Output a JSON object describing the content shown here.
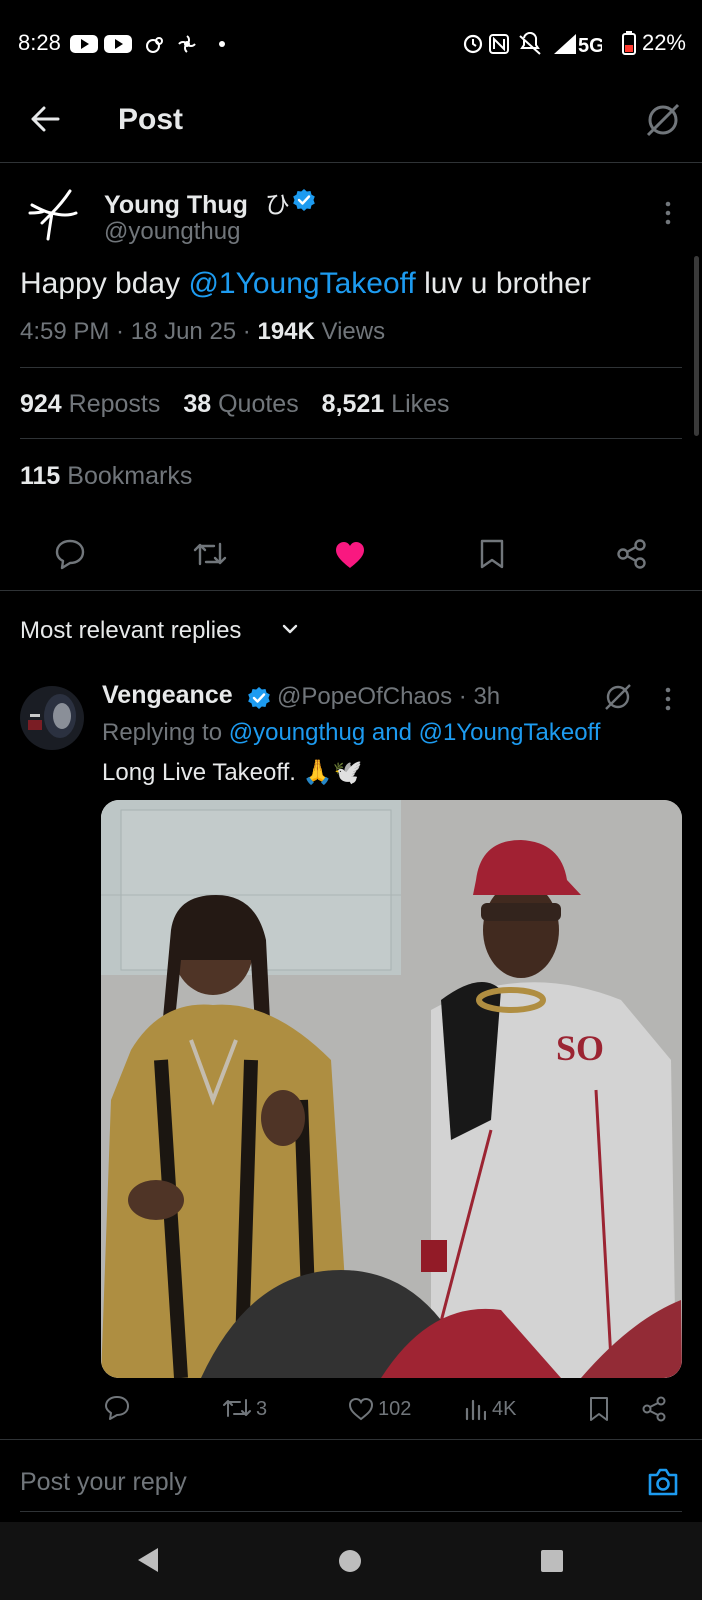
{
  "status_bar": {
    "time": "8:28",
    "network": "5G",
    "battery": "22%"
  },
  "header": {
    "title": "Post"
  },
  "tweet": {
    "author_name": "Young Thug",
    "author_badge_glyph": "ひ",
    "author_handle": "@youngthug",
    "text_prefix": "Happy bday ",
    "text_mention": "@1YoungTakeoff",
    "text_suffix": " luv u brother",
    "time": "4:59 PM",
    "date": "18 Jun 25",
    "views_count": "194K",
    "views_label": " Views",
    "reposts_count": "924",
    "reposts_label": " Reposts",
    "quotes_count": "38",
    "quotes_label": " Quotes",
    "likes_count": "8,521",
    "likes_label": " Likes",
    "bookmarks_count": "115",
    "bookmarks_label": " Bookmarks",
    "liked": true
  },
  "replies_sort": {
    "label": "Most relevant replies"
  },
  "reply": {
    "author_name": "Vengeance",
    "author_handle": "@PopeOfChaos",
    "time_ago": "3h",
    "replying_to_label": "Replying to ",
    "replying_to_targets": "@youngthug and @1YoungTakeoff",
    "text": "Long Live Takeoff. 🙏🕊️",
    "reposts": "3",
    "likes": "102",
    "views": "4K"
  },
  "compose": {
    "placeholder": "Post your reply"
  },
  "colors": {
    "accent": "#1d9bf0",
    "like": "#f91880",
    "background": "#000000",
    "muted": "#71767b"
  }
}
